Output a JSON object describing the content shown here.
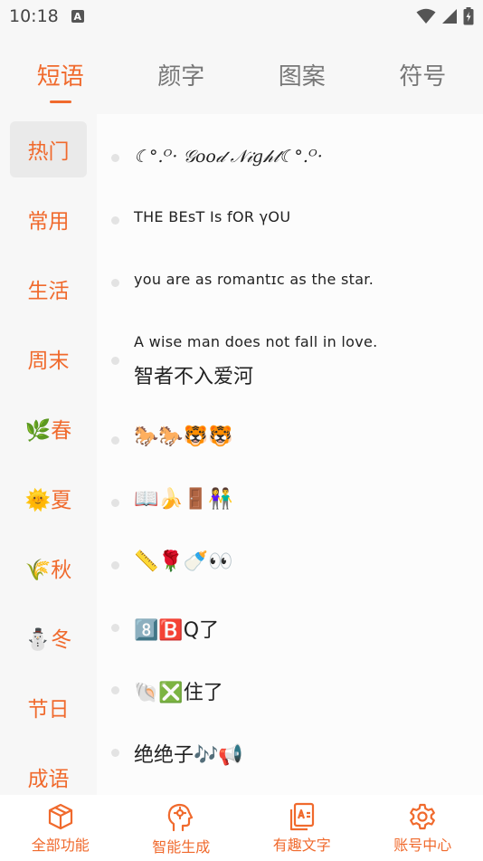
{
  "status": {
    "time": "10:18",
    "badge": "A"
  },
  "tabs": [
    {
      "label": "短语",
      "active": true
    },
    {
      "label": "颜字",
      "active": false
    },
    {
      "label": "图案",
      "active": false
    },
    {
      "label": "符号",
      "active": false
    }
  ],
  "categories": [
    {
      "label": "热门",
      "active": true
    },
    {
      "label": "常用"
    },
    {
      "label": "生活"
    },
    {
      "label": "周末"
    },
    {
      "label": "🌿春"
    },
    {
      "label": "🌞夏"
    },
    {
      "label": "🌾秋"
    },
    {
      "label": "⛄冬"
    },
    {
      "label": "节日"
    },
    {
      "label": "成语"
    }
  ],
  "phrases": [
    {
      "line1": "☾°.ᴼ· 𝒢𝑜𝑜𝒹 𝒩𝒾𝑔𝒽𝓉☾°.ᴼ·"
    },
    {
      "line1": "THE  BEsT   Is    fOR    γOU"
    },
    {
      "line1": "you are as romantɪc as the star."
    },
    {
      "line1": "A wise man does not fall in love.",
      "line2": "智者不入爱河"
    },
    {
      "line1": "🐎🐎🐯🐯"
    },
    {
      "line1": "📖🍌🚪👫"
    },
    {
      "line1": "📏🌹🍼👀"
    },
    {
      "line1": "8️⃣🅱️Q了"
    },
    {
      "line1": "🐚❎住了"
    },
    {
      "line1": "绝绝子🎶📢"
    }
  ],
  "bottom_nav": [
    {
      "label": "全部功能",
      "icon": "cube-icon"
    },
    {
      "label": "智能生成",
      "icon": "ai-head-icon"
    },
    {
      "label": "有趣文字",
      "icon": "text-doc-icon"
    },
    {
      "label": "账号中心",
      "icon": "gear-icon"
    }
  ],
  "colors": {
    "accent": "#f06a2d",
    "inactive": "#777777",
    "background": "#f7f7f7"
  }
}
